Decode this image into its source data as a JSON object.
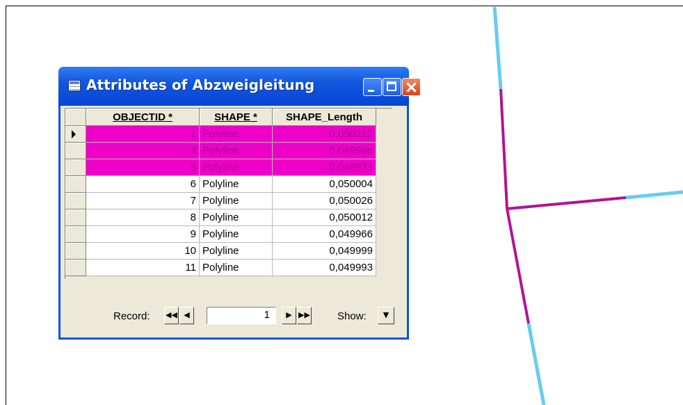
{
  "window": {
    "title": "Attributes of Abzweigleitung"
  },
  "table": {
    "columns": [
      "OBJECTID *",
      "SHAPE *",
      "SHAPE_Length"
    ],
    "rows": [
      {
        "objectid": "1",
        "shape": "Polyline",
        "length": "0,050212",
        "selected": true,
        "current": true
      },
      {
        "objectid": "3",
        "shape": "Polyline",
        "length": "0,049998",
        "selected": true
      },
      {
        "objectid": "5",
        "shape": "Polyline",
        "length": "0,049973",
        "selected": true
      },
      {
        "objectid": "6",
        "shape": "Polyline",
        "length": "0,050004"
      },
      {
        "objectid": "7",
        "shape": "Polyline",
        "length": "0,050026"
      },
      {
        "objectid": "8",
        "shape": "Polyline",
        "length": "0,050012"
      },
      {
        "objectid": "9",
        "shape": "Polyline",
        "length": "0,049966"
      },
      {
        "objectid": "10",
        "shape": "Polyline",
        "length": "0,049999"
      },
      {
        "objectid": "11",
        "shape": "Polyline",
        "length": "0,049993"
      }
    ]
  },
  "nav": {
    "record_label": "Record:",
    "record_value": "1",
    "show_label": "Show:"
  },
  "colors": {
    "selected": "#ee00c8",
    "line_cyan": "#66ccee",
    "line_magenta": "#b0129a",
    "title_blue": "#0a54e3"
  }
}
